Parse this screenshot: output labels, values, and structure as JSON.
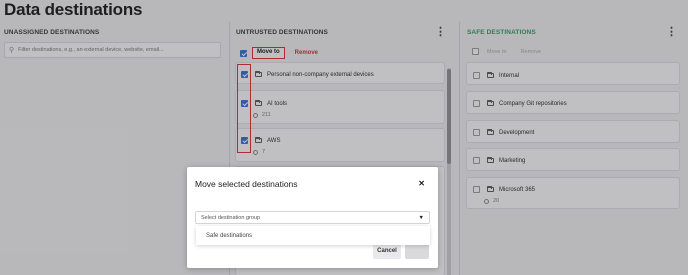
{
  "page": {
    "title": "Data destinations"
  },
  "columns": {
    "unassigned": {
      "header": "UNASSIGNED DESTINATIONS",
      "filter_placeholder": "Filter destinations, e.g., an external device, website, email..."
    },
    "untrusted": {
      "header": "UNTRUSTED DESTINATIONS",
      "toolbar": {
        "move_label": "Move to",
        "remove_label": "Remove"
      },
      "items": [
        {
          "label": "Personal non-company external devices",
          "checked": true
        },
        {
          "label": "AI tools",
          "count": "211",
          "checked": true
        },
        {
          "label": "AWS",
          "count": "7",
          "checked": true
        }
      ]
    },
    "safe": {
      "header": "SAFE DESTINATIONS",
      "toolbar": {
        "move_label": "Move to",
        "remove_label": "Remove"
      },
      "items": [
        {
          "label": "Internal"
        },
        {
          "label": "Company Git repositories"
        },
        {
          "label": "Development"
        },
        {
          "label": "Marketing"
        },
        {
          "label": "Microsoft 365",
          "count": "20"
        }
      ]
    }
  },
  "modal": {
    "title": "Move selected destinations",
    "select_placeholder": "Select destination group",
    "option": "Safe destinations",
    "cancel_label": "Cancel"
  },
  "colors": {
    "accent": "#2a6fd6",
    "danger": "#e0262f",
    "safe": "#2e9a5a"
  },
  "icons": [
    "kebab-icon",
    "search-icon",
    "folder-icon",
    "globe-icon",
    "close-icon",
    "caret-down-icon",
    "checkbox-icon"
  ]
}
